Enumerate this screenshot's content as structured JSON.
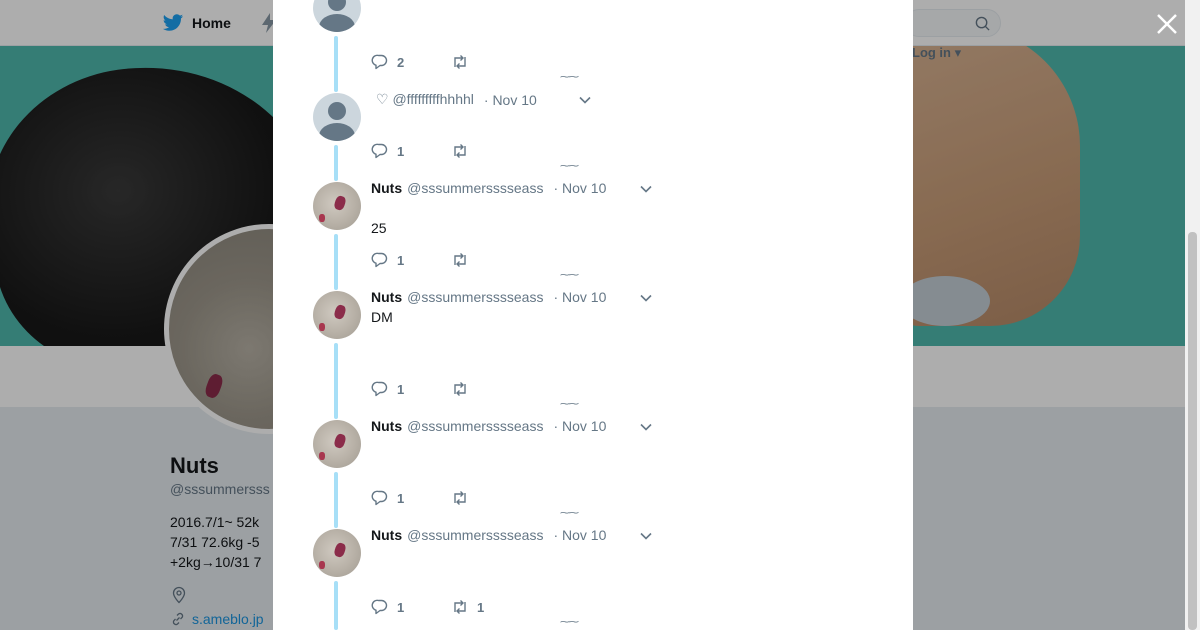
{
  "nav": {
    "home_label": "Home",
    "login_label": "Log in"
  },
  "profile": {
    "name": "Nuts",
    "handle": "@sssummersss",
    "bio_lines": [
      "2016.7/1~ 52k",
      "7/31 72.6kg -5",
      "+2kg→10/31 7"
    ],
    "link": "s.ameblo.jp"
  },
  "tweets": [
    {
      "replies": "2",
      "retweets": ""
    },
    {
      "name": "",
      "handle": "♡ @fffffffffhhhhl",
      "time": "· Nov 10",
      "text": "",
      "replies": "1",
      "retweets": ""
    },
    {
      "name": "Nuts",
      "handle": "@sssummersssseass",
      "time": "· Nov 10",
      "text": "25",
      "replies": "1",
      "retweets": ""
    },
    {
      "name": "Nuts",
      "handle": "@sssummersssseass",
      "time": "· Nov 10",
      "text": "DM",
      "replies": "1",
      "retweets": ""
    },
    {
      "name": "Nuts",
      "handle": "@sssummersssseass",
      "time": "· Nov 10",
      "text": "",
      "replies": "1",
      "retweets": ""
    },
    {
      "name": "Nuts",
      "handle": "@sssummersssseass",
      "time": "· Nov 10",
      "text": "",
      "replies": "1",
      "retweets": "1"
    }
  ],
  "colors": {
    "twitter_blue": "#1da1f2",
    "thread_line": "#a7dff7",
    "banner": "#4fb8ad"
  },
  "icons": [
    "twitter-bird-icon",
    "search-icon",
    "close-icon",
    "reply-icon",
    "retweet-icon",
    "chevron-down-icon",
    "location-icon",
    "link-icon"
  ]
}
